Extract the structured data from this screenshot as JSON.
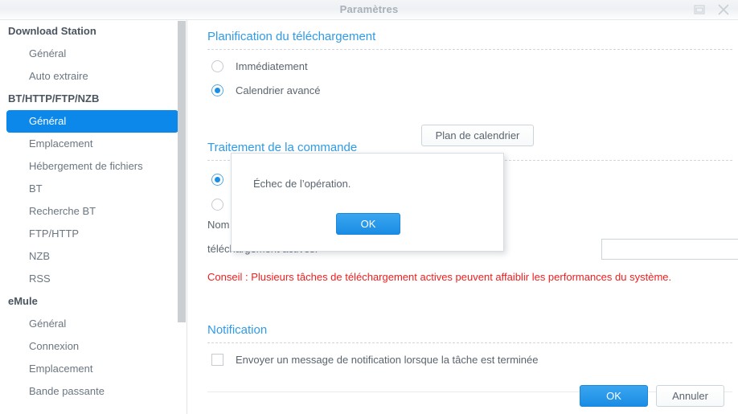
{
  "window": {
    "title": "Paramètres",
    "controls": [
      {
        "name": "maximize",
        "icon": "maximize-icon"
      },
      {
        "name": "close",
        "icon": "close-icon"
      }
    ]
  },
  "sidebar": {
    "groups": [
      {
        "title": "Download Station",
        "items": [
          {
            "label": "Général",
            "selected": false
          },
          {
            "label": "Auto extraire",
            "selected": false
          }
        ]
      },
      {
        "title": "BT/HTTP/FTP/NZB",
        "items": [
          {
            "label": "Général",
            "selected": true
          },
          {
            "label": "Emplacement",
            "selected": false
          },
          {
            "label": "Hébergement de fichiers",
            "selected": false
          },
          {
            "label": "BT",
            "selected": false
          },
          {
            "label": "Recherche BT",
            "selected": false
          },
          {
            "label": "FTP/HTTP",
            "selected": false
          },
          {
            "label": "NZB",
            "selected": false
          },
          {
            "label": "RSS",
            "selected": false
          }
        ]
      },
      {
        "title": "eMule",
        "items": [
          {
            "label": "Général",
            "selected": false
          },
          {
            "label": "Connexion",
            "selected": false
          },
          {
            "label": "Emplacement",
            "selected": false
          },
          {
            "label": "Bande passante",
            "selected": false
          }
        ]
      }
    ]
  },
  "content": {
    "sections": [
      {
        "title": "Planification du téléchargement"
      },
      {
        "title": "Traitement de la commande"
      },
      {
        "title": "Notification"
      }
    ],
    "schedule": {
      "option_immediate": "Immédiatement",
      "option_advanced": "Calendrier avancé",
      "selected": "advanced",
      "plan_button": "Plan de calendrier"
    },
    "command": {
      "label_partial_1": "Nom",
      "label_partial_2": "téléchargement actives.",
      "tip": "Conseil : Plusieurs tâches de téléchargement actives peuvent affaiblir les performances du système."
    },
    "notification": {
      "checkbox_label": "Envoyer un message de notification lorsque la tâche est terminée",
      "checked": false
    },
    "footer": {
      "ok_label": "OK",
      "cancel_label": "Annuler"
    }
  },
  "modal": {
    "message": "Échec de l’opération.",
    "ok_label": "OK"
  },
  "colors": {
    "accent_blue": "#0c88ea",
    "section_heading": "#2f9be8",
    "tip_red": "#f01e1e",
    "text": "#5a646e"
  }
}
